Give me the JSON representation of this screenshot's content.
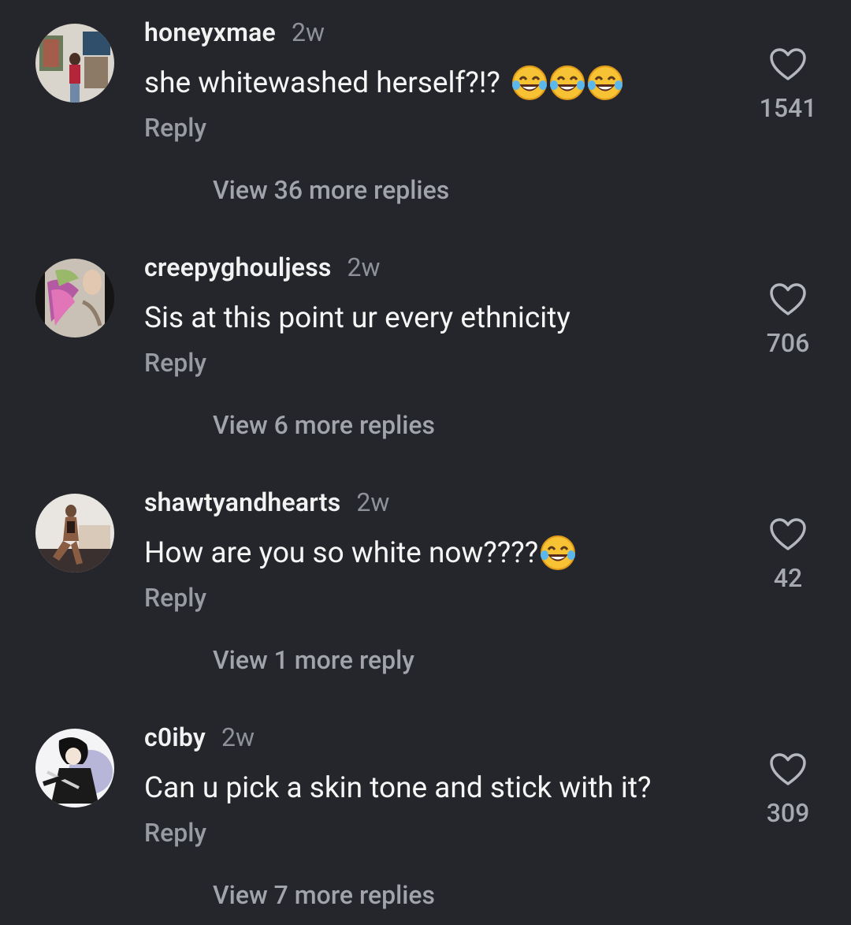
{
  "comments": [
    {
      "username": "honeyxmae",
      "time": "2w",
      "text": "she whitewashed herself?!?",
      "emoji_count": 3,
      "reply_label": "Reply",
      "view_replies": "View 36 more replies",
      "likes": "1541"
    },
    {
      "username": "creepyghouljess",
      "time": "2w",
      "text": "Sis at this point ur every ethnicity",
      "emoji_count": 0,
      "reply_label": "Reply",
      "view_replies": "View 6 more replies",
      "likes": "706"
    },
    {
      "username": "shawtyandhearts",
      "time": "2w",
      "text": "How are you so white now????",
      "emoji_count": 1,
      "reply_label": "Reply",
      "view_replies": "View 1 more reply",
      "likes": "42"
    },
    {
      "username": "c0iby",
      "time": "2w",
      "text": "Can u pick a skin tone and stick with it?",
      "emoji_count": 0,
      "reply_label": "Reply",
      "view_replies": "View 7 more replies",
      "likes": "309"
    }
  ],
  "icons": {
    "like": "heart-outline-icon",
    "emoji": "face-with-tears-of-joy-icon"
  },
  "colors": {
    "background": "#24262b",
    "username": "#f2f2f2",
    "muted": "#989ba2"
  }
}
